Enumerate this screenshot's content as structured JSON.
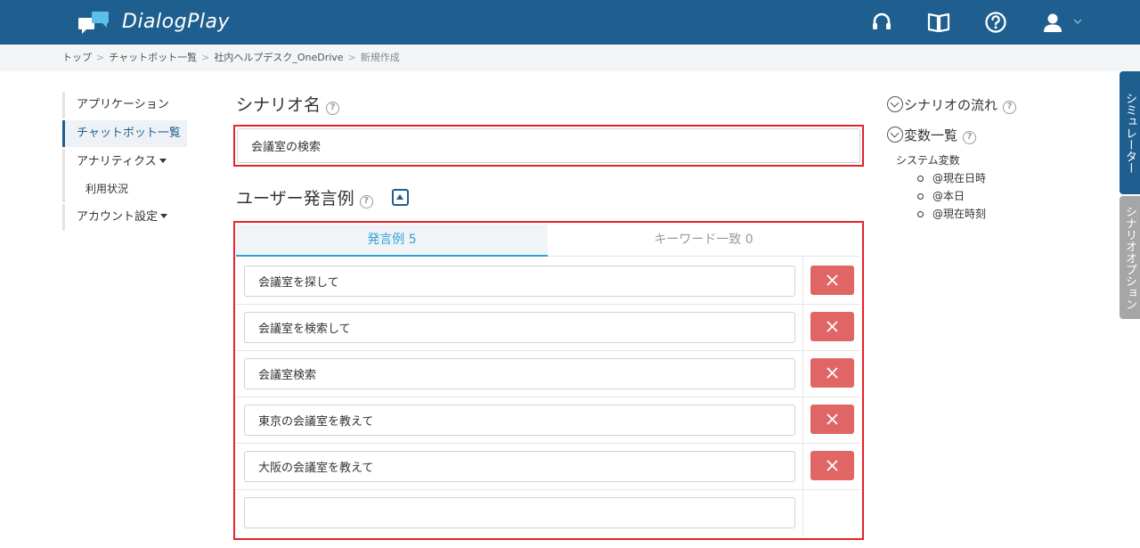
{
  "app": {
    "brand": "DialogPlay"
  },
  "breadcrumb": {
    "items": [
      "トップ",
      "チャットボット一覧",
      "社内ヘルプデスク_OneDrive"
    ],
    "current": "新規作成",
    "separator": ">"
  },
  "sidenav": {
    "applications": "アプリケーション",
    "chatbot_list": "チャットボット一覧",
    "analytics": "アナリティクス",
    "usage": "利用状況",
    "account_settings": "アカウント設定"
  },
  "scenario": {
    "heading": "シナリオ名",
    "name_value": "会議室の検索"
  },
  "utterances": {
    "heading": "ユーザー発言例",
    "tab_examples": "発言例 5",
    "tab_keywords": "キーワード一致 0",
    "items": [
      "会議室を探して",
      "会議室を検索して",
      "会議室検索",
      "東京の会議室を教えて",
      "大阪の会議室を教えて"
    ],
    "new_value": ""
  },
  "right_panel": {
    "flow": "シナリオの流れ",
    "variables": "変数一覧",
    "system_vars_title": "システム変数",
    "system_vars": [
      "@現在日時",
      "@本日",
      "@現在時刻"
    ]
  },
  "side_tabs": {
    "simulator": "シミュレーター",
    "scenario_options": "シナリオオプション"
  },
  "colors": {
    "header": "#1f5f8f",
    "accent": "#2ba3d8",
    "delete": "#e06666",
    "highlight_border": "#e2252b"
  },
  "icons": [
    "headset-icon",
    "book-icon",
    "help-icon",
    "user-icon",
    "close-icon"
  ]
}
